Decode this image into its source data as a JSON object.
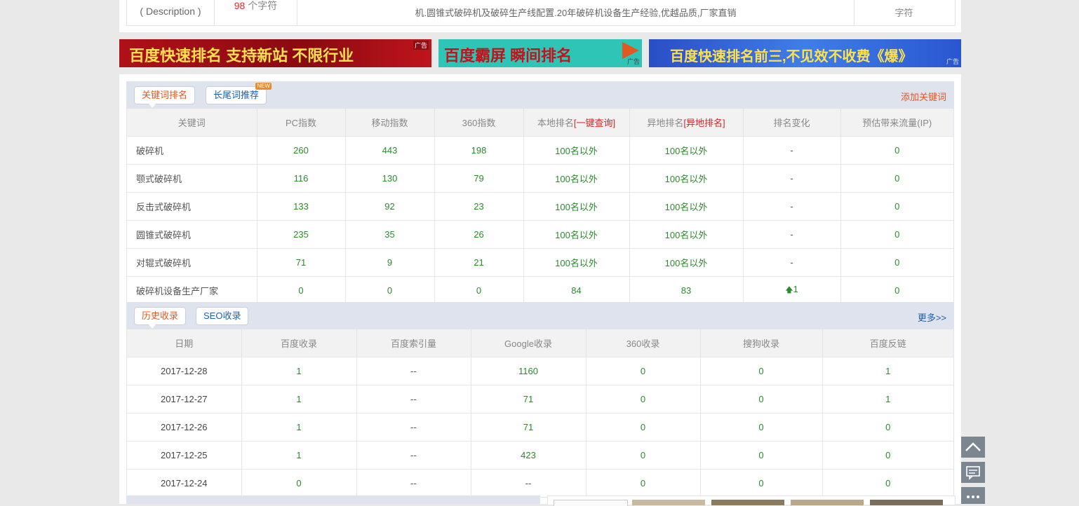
{
  "description_row": {
    "label": "( Description )",
    "count_number": "98",
    "count_suffix": " 个字符",
    "text": "机.圆锥式破碎机及破碎生产线配置.20年破碎机设备生产经验,优越品质,厂家直销",
    "tail": "字符"
  },
  "banners": [
    {
      "text": "百度快速排名  支持新站  不限行业",
      "tag": "广告"
    },
    {
      "text": "百度霸屏  瞬间排名",
      "tag": "广告"
    },
    {
      "text": "百度快速排名前三,不见效不收费《爆》",
      "tag": "广告"
    }
  ],
  "keyword_section": {
    "tab_active": "关键词排名",
    "tab_other": "长尾词推荐",
    "new_badge": "NEW",
    "add_link": "添加关键词",
    "columns": [
      "关键词",
      "PC指数",
      "移动指数",
      "360指数",
      "本地排名",
      "异地排名",
      "排名变化",
      "预估带来流量(IP)"
    ],
    "local_query_link": "[一键查询]",
    "remote_query_link": "[异地排名]",
    "rows": [
      {
        "kw": "破碎机",
        "pc": "260",
        "mobile": "443",
        "s360": "198",
        "local": "100名以外",
        "remote": "100名以外",
        "change": "-",
        "traffic": "0"
      },
      {
        "kw": "颚式破碎机",
        "pc": "116",
        "mobile": "130",
        "s360": "79",
        "local": "100名以外",
        "remote": "100名以外",
        "change": "-",
        "traffic": "0"
      },
      {
        "kw": "反击式破碎机",
        "pc": "133",
        "mobile": "92",
        "s360": "23",
        "local": "100名以外",
        "remote": "100名以外",
        "change": "-",
        "traffic": "0"
      },
      {
        "kw": "圆锥式破碎机",
        "pc": "235",
        "mobile": "35",
        "s360": "26",
        "local": "100名以外",
        "remote": "100名以外",
        "change": "-",
        "traffic": "0"
      },
      {
        "kw": "对辊式破碎机",
        "pc": "71",
        "mobile": "9",
        "s360": "21",
        "local": "100名以外",
        "remote": "100名以外",
        "change": "-",
        "traffic": "0"
      },
      {
        "kw": "破碎机设备生产厂家",
        "pc": "0",
        "mobile": "0",
        "s360": "0",
        "local": "84",
        "remote": "83",
        "change": "1",
        "change_icon": "up-arrow-icon",
        "traffic": "0"
      }
    ]
  },
  "history_section": {
    "tab_active": "历史收录",
    "tab_other": "SEO收录",
    "more_link": "更多>>",
    "columns": [
      "日期",
      "百度收录",
      "百度索引量",
      "Google收录",
      "360收录",
      "搜狗收录",
      "百度反链"
    ],
    "rows": [
      {
        "date": "2017-12-28",
        "baidu": "1",
        "index": "--",
        "google": "1160",
        "s360": "0",
        "sogou": "0",
        "backlink": "1"
      },
      {
        "date": "2017-12-27",
        "baidu": "1",
        "index": "--",
        "google": "71",
        "s360": "0",
        "sogou": "0",
        "backlink": "1"
      },
      {
        "date": "2017-12-26",
        "baidu": "1",
        "index": "--",
        "google": "71",
        "s360": "0",
        "sogou": "0",
        "backlink": "0"
      },
      {
        "date": "2017-12-25",
        "baidu": "1",
        "index": "--",
        "google": "423",
        "s360": "0",
        "sogou": "0",
        "backlink": "0"
      },
      {
        "date": "2017-12-24",
        "baidu": "0",
        "index": "--",
        "google": "--",
        "s360": "0",
        "sogou": "0",
        "backlink": "0"
      }
    ]
  },
  "side_buttons": [
    "back-to-top-icon",
    "feedback-icon",
    "more-icon"
  ],
  "colors": {
    "accent_orange": "#e4571e",
    "link_blue": "#1f5fa8",
    "value_green": "#2b8a2b",
    "alert_red": "#d22222",
    "head_bg": "#dfe3ee"
  }
}
